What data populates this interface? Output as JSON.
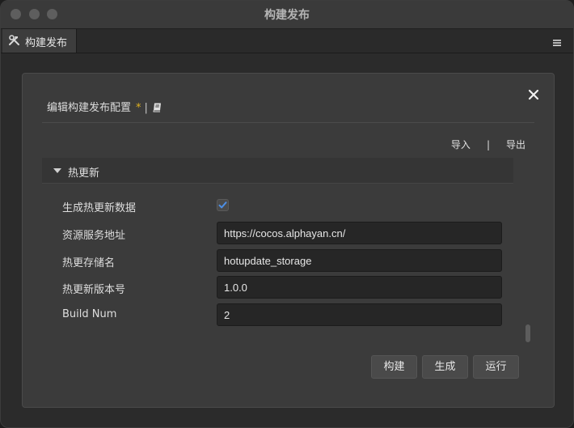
{
  "window": {
    "title": "构建发布"
  },
  "tabs": [
    {
      "label": "构建发布",
      "icon": "hammer-wrench-icon"
    }
  ],
  "panel": {
    "menu_icon": "hamburger-menu-icon"
  },
  "dialog": {
    "title": "编辑构建发布配置",
    "modified_marker": "*",
    "separator": "|",
    "doc_icon": "book-icon",
    "close_icon": "close-icon",
    "import_label": "导入",
    "io_separator": "|",
    "export_label": "导出",
    "section": {
      "label": "热更新",
      "expanded": true
    },
    "fields": {
      "generate_label": "生成热更新数据",
      "generate_checked": true,
      "resource_url_label": "资源服务地址",
      "resource_url_value": "https://cocos.alphayan.cn/",
      "storage_label": "热更存储名",
      "storage_value": "hotupdate_storage",
      "version_label": "热更新版本号",
      "version_value": "1.0.0",
      "build_num_label": "Build Num",
      "build_num_value": "2"
    },
    "buttons": {
      "build": "构建",
      "generate": "生成",
      "run": "运行"
    }
  },
  "colors": {
    "window_bg": "#2b2b2b",
    "dialog_bg": "#3b3b3b",
    "input_bg": "#262626",
    "checkbox_accent": "#4d8fe6",
    "modified_marker": "#e0b21f"
  }
}
